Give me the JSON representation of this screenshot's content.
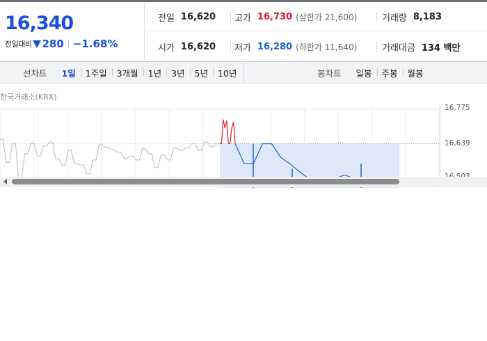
{
  "quote": {
    "price": "16,340",
    "change_label": "전일대비",
    "direction_icon": "triangle-down-icon",
    "change": "280",
    "change_pct": "−1.68%",
    "prev_close_label": "전일",
    "prev_close": "16,620",
    "high_label": "고가",
    "high": "16,730",
    "upper_limit": "(상한가 21,600)",
    "volume_label": "거래량",
    "volume": "8,183",
    "open_label": "시가",
    "open": "16,620",
    "low_label": "저가",
    "low": "16,280",
    "lower_limit": "(하한가 11,640)",
    "turnover_label": "거래대금",
    "turnover": "134 백만"
  },
  "tabs": {
    "line_title": "선차트",
    "line": [
      "1일",
      "1주일",
      "3개월",
      "1년",
      "3년",
      "5년",
      "10년"
    ],
    "line_active": "1일",
    "candle_title": "봉차트",
    "candle": [
      "일봉",
      "주봉",
      "월봉"
    ]
  },
  "chart": {
    "exchange": "한국거래소(KRX)",
    "y_ticks": [
      "16,775",
      "16,639",
      "16,503"
    ]
  },
  "chart_data": {
    "type": "line",
    "title": "",
    "xlabel": "",
    "ylabel": "",
    "ylim": [
      16503,
      16775
    ],
    "reference_line": 16639,
    "series": [
      {
        "color": "#c4c4c4",
        "values": [
          16655,
          16655,
          16565,
          16565,
          16640,
          16640,
          16503,
          16503,
          16600,
          16600,
          16640,
          16640,
          16590,
          16590,
          16630,
          16630,
          16645,
          16645,
          16580,
          16580,
          16555,
          16555,
          16612,
          16612,
          16560,
          16560,
          16555,
          16555,
          16520,
          16520,
          16575,
          16575,
          16635,
          16635,
          16625,
          16625,
          16615,
          16615,
          16605,
          16605,
          16580,
          16580,
          16590,
          16590,
          16575,
          16575,
          16620,
          16620,
          16600,
          16600,
          16545,
          16545,
          16595,
          16595,
          16575,
          16575,
          16622,
          16622,
          16614,
          16614,
          16622,
          16622,
          16640,
          16640,
          16612,
          16612,
          16645,
          16645,
          16627,
          16627,
          16639,
          16639
        ]
      },
      {
        "color": "#e01e2f",
        "values": [
          16640,
          16640,
          16735,
          16700,
          16730,
          16640,
          16640,
          16700,
          16725,
          16640
        ]
      },
      {
        "color": "#1a62d6",
        "values": [
          16639,
          16560,
          16560,
          16639,
          16639,
          16585,
          16560,
          16530,
          16503,
          16503,
          16503,
          16503,
          16515,
          16503,
          16503,
          16503,
          16503,
          16503,
          16503
        ]
      }
    ]
  },
  "colors": {
    "price_down": "#1a4fd6",
    "price_up": "#e01e2f",
    "area_fill": "#dfe8f8"
  }
}
